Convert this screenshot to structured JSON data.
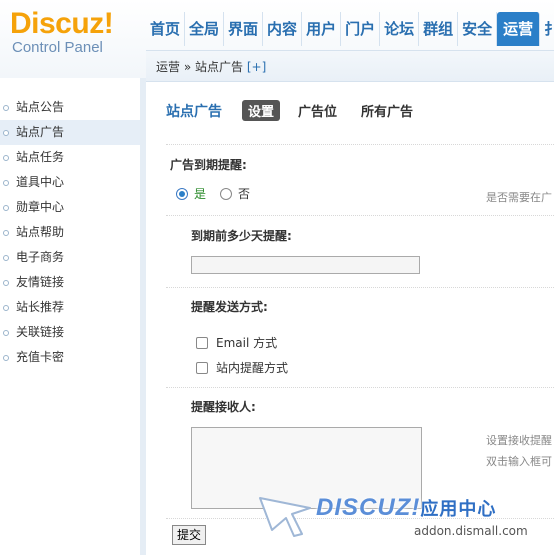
{
  "logo": {
    "title": "Discuz!",
    "subtitle": "Control Panel"
  },
  "nav": {
    "items": [
      "首页",
      "全局",
      "界面",
      "内容",
      "用户",
      "门户",
      "论坛",
      "群组",
      "安全",
      "运营",
      "扌"
    ],
    "active_index": 9
  },
  "breadcrumb": {
    "section": "运营",
    "separator": "»",
    "page": "站点广告",
    "add": "[+]"
  },
  "sidebar": {
    "items": [
      "站点公告",
      "站点广告",
      "站点任务",
      "道具中心",
      "勋章中心",
      "站点帮助",
      "电子商务",
      "友情链接",
      "站长推荐",
      "关联链接",
      "充值卡密"
    ],
    "active_index": 1
  },
  "main": {
    "title": "站点广告",
    "tabs": [
      "设置",
      "广告位",
      "所有广告"
    ],
    "active_tab": 0,
    "expire_notice": {
      "label": "广告到期提醒:",
      "yes": "是",
      "no": "否",
      "selected": "yes",
      "hint": "是否需要在广"
    },
    "days_before": {
      "label": "到期前多少天提醒:",
      "value": ""
    },
    "notify_method": {
      "label": "提醒发送方式:",
      "options": [
        {
          "label": "Email 方式",
          "checked": false
        },
        {
          "label": "站内提醒方式",
          "checked": false
        }
      ]
    },
    "recipients": {
      "label": "提醒接收人:",
      "value": "",
      "hint_line1": "设置接收提醒",
      "hint_line2": "双击输入框可"
    },
    "submit_label": "提交"
  },
  "watermark": {
    "logo": "DISCUZ!",
    "cn": "应用中心",
    "url": "addon.dismall.com"
  }
}
